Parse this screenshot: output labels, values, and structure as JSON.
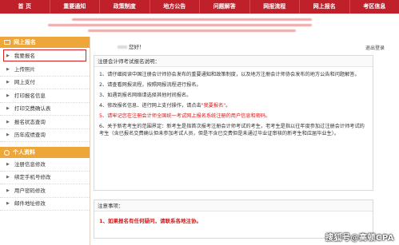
{
  "nav": {
    "items": [
      "首 页",
      "重要通知",
      "政策制度",
      "地方公告",
      "问题解答",
      "网报流程",
      "网上报名",
      "考区信息"
    ]
  },
  "sidebar": {
    "section1_title": "网上报名",
    "section1_items": [
      "我要报名",
      "上传照片",
      "网上支付",
      "打印报名信息",
      "打印交费确认表",
      "报名状态查询",
      "历年成绩查询"
    ],
    "section2_title": "个人资料",
    "section2_items": [
      "注册信息修改",
      "绑定手机号修改",
      "用户密码修改",
      "邮件地址修改"
    ]
  },
  "main": {
    "greeting": "您好！",
    "logout": "退出登录",
    "notice_title": "注册会计师考试报名说明：",
    "paragraphs": [
      "1、请仔细阅读中国注册会计师协会发布的重要通知和政策制度，以及地方注册会计师协会发布的地方公告和问题解答。",
      "2、请查看网报流程，按照网报流程进行报名。",
      "3、如遇到报名网络请选择其他时间报名。",
      "4、修改报名信息、进行网上支付操作，请点击",
      "5、请牢记您在注册会计师全国统一考试网上报名系统注册的用户信息和密码。",
      "6、关于新老考生的范围界定：新考生是指首次报考注册会计师考试的考生，老考生是指以往年度参加过注册会计师考试的考生（含已报名交费确认但未参加考试人员，但是不含已交费但是未通过毕业证审核的新考生和应届毕业生）。"
    ],
    "p4_link": "\"我要报名\"",
    "p4_end": "。",
    "attention_title": "注意事项：",
    "attention_text": "1、如果报名有任何疑问，请联系各地注协。"
  },
  "watermark": "搜狐号@高顿CPA",
  "colors": {
    "nav_bg": "#c0202a",
    "sidebar_header": "#eca63a",
    "alert_red": "#d61818",
    "active_border": "#d71f1f"
  }
}
